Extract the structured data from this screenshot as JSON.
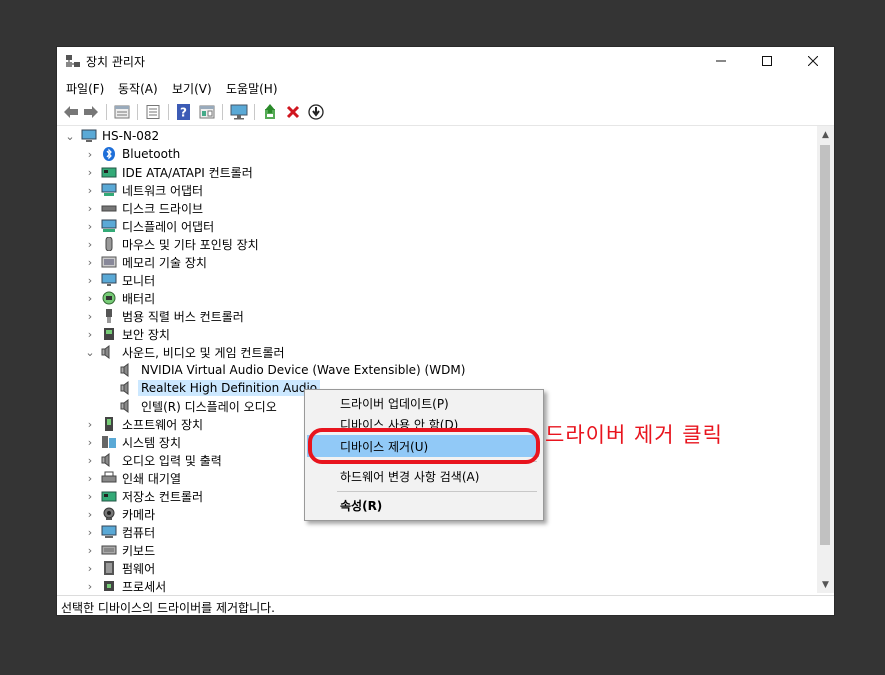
{
  "window": {
    "title": "장치 관리자"
  },
  "menu": [
    "파일(F)",
    "동작(A)",
    "보기(V)",
    "도움말(H)"
  ],
  "toolbar": [
    {
      "icon": "back-arrow-icon"
    },
    {
      "icon": "forward-arrow-icon"
    },
    {
      "icon": "properties-icon"
    },
    {
      "icon": "list-view-icon"
    },
    {
      "icon": "help-icon"
    },
    {
      "icon": "resource-view-icon"
    },
    {
      "icon": "scan-monitor-icon"
    },
    {
      "icon": "update-driver-icon"
    },
    {
      "icon": "uninstall-x-icon"
    },
    {
      "icon": "download-circle-icon"
    }
  ],
  "tree": {
    "root": "HS-N-082",
    "categories": [
      {
        "label": "Bluetooth",
        "icon": "bluetooth-icon"
      },
      {
        "label": "IDE ATA/ATAPI 컨트롤러",
        "icon": "ide-controller-icon"
      },
      {
        "label": "네트워크 어댑터",
        "icon": "network-adapter-icon"
      },
      {
        "label": "디스크 드라이브",
        "icon": "disk-drive-icon"
      },
      {
        "label": "디스플레이 어댑터",
        "icon": "display-adapter-icon"
      },
      {
        "label": "마우스 및 기타 포인팅 장치",
        "icon": "mouse-icon"
      },
      {
        "label": "메모리 기술 장치",
        "icon": "memory-device-icon"
      },
      {
        "label": "모니터",
        "icon": "monitor-icon"
      },
      {
        "label": "배터리",
        "icon": "battery-icon"
      },
      {
        "label": "범용 직렬 버스 컨트롤러",
        "icon": "usb-icon"
      },
      {
        "label": "보안 장치",
        "icon": "security-device-icon"
      },
      {
        "label": "사운드, 비디오 및 게임 컨트롤러",
        "icon": "speaker-icon"
      },
      {
        "label": "소프트웨어 장치",
        "icon": "software-device-icon"
      },
      {
        "label": "시스템 장치",
        "icon": "system-device-icon"
      },
      {
        "label": "오디오 입력 및 출력",
        "icon": "audio-io-icon"
      },
      {
        "label": "인쇄 대기열",
        "icon": "printer-icon"
      },
      {
        "label": "저장소 컨트롤러",
        "icon": "storage-controller-icon"
      },
      {
        "label": "카메라",
        "icon": "camera-icon"
      },
      {
        "label": "컴퓨터",
        "icon": "computer-icon"
      },
      {
        "label": "키보드",
        "icon": "keyboard-icon"
      },
      {
        "label": "펌웨어",
        "icon": "firmware-icon"
      },
      {
        "label": "프로세서",
        "icon": "processor-icon"
      }
    ],
    "sound_children": [
      "NVIDIA Virtual Audio Device (Wave Extensible) (WDM)",
      "Realtek High Definition Audio",
      "인텔(R) 디스플레이 오디오"
    ]
  },
  "context_menu": {
    "items": [
      "드라이버 업데이트(P)",
      "디바이스 사용 안 함(D)",
      "디바이스 제거(U)",
      "하드웨어 변경 사항 검색(A)",
      "속성(R)"
    ],
    "highlighted_index": 2
  },
  "annotation": "드라이버 제거 클릭",
  "status": "선택한 디바이스의 드라이버를 제거합니다.",
  "colors": {
    "accent": "#91c9f7",
    "annotation": "#e8141e",
    "selection": "#cce8ff"
  }
}
